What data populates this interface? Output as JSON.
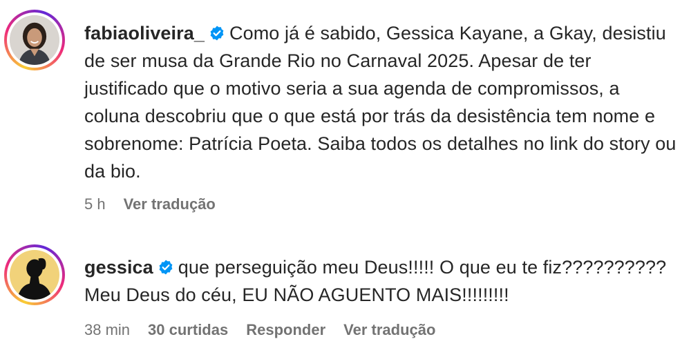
{
  "comments": [
    {
      "username": "fabiaoliveira_",
      "verified": true,
      "text": "Como já é sabido, Gessica Kayane, a Gkay, desistiu de ser musa da Grande Rio no Carnaval 2025. Apesar de ter justificado que o motivo seria a sua agenda de compromissos, a coluna descobriu que o que está por trás da desistência tem nome e sobrenome: Patrícia Poeta. Saiba todos os detalhes no link do story ou da bio.",
      "time": "5 h",
      "translate_label": "Ver tradução"
    },
    {
      "username": "gessica",
      "verified": true,
      "text": "que perseguição meu Deus!!!!! O que eu te fiz?????????? Meu Deus do céu, EU NÃO AGUENTO MAIS!!!!!!!!!",
      "time": "38 min",
      "likes_label": "30 curtidas",
      "reply_label": "Responder",
      "translate_label": "Ver tradução"
    }
  ],
  "colors": {
    "text": "#262626",
    "meta": "#737373",
    "verified": "#0095f6"
  },
  "icons": [
    "verified-badge-icon"
  ]
}
